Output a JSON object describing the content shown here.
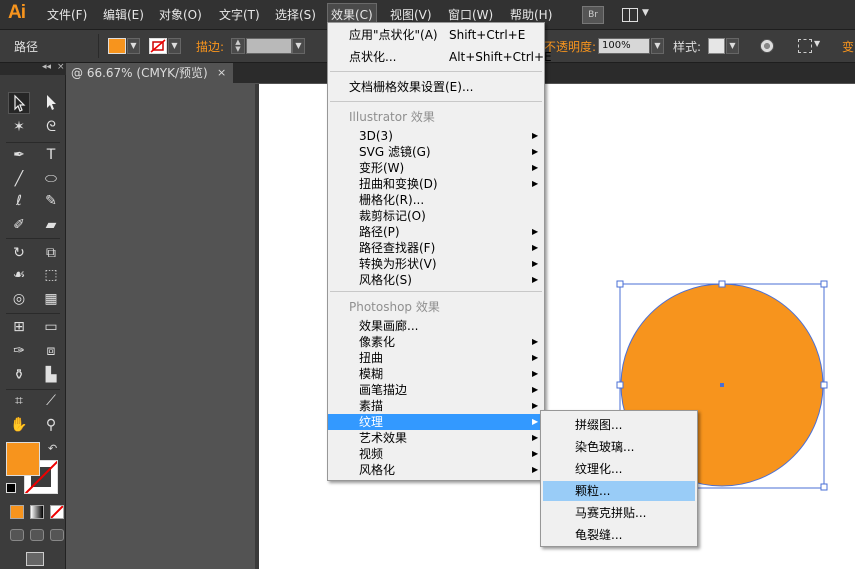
{
  "app": {
    "logo": "Ai"
  },
  "menubar": {
    "items": [
      {
        "label": "文件(F)"
      },
      {
        "label": "编辑(E)"
      },
      {
        "label": "对象(O)"
      },
      {
        "label": "文字(T)"
      },
      {
        "label": "选择(S)"
      },
      {
        "label": "效果(C)"
      },
      {
        "label": "视图(V)"
      },
      {
        "label": "窗口(W)"
      },
      {
        "label": "帮助(H)"
      }
    ],
    "active": "效果(C)",
    "bridge_label": "Br"
  },
  "controlbar": {
    "selection_label": "路径",
    "stroke_label": "描边:",
    "opacity_label": "不透明度:",
    "opacity_value": "100%",
    "style_label": "样式:",
    "transform_label": "变",
    "fill_color": "#f7941d"
  },
  "document": {
    "tab_title": "@ 66.67% (CMYK/预览)",
    "close": "×"
  },
  "tools": {
    "collapse": "◂◂",
    "close": "×"
  },
  "effect_menu": {
    "top_items": [
      {
        "label": "应用\"点状化\"(A)",
        "shortcut": "Shift+Ctrl+E"
      },
      {
        "label": "点状化...",
        "shortcut": "Alt+Shift+Ctrl+E"
      }
    ],
    "raster_settings": "文档栅格效果设置(E)...",
    "illustrator_header": "Illustrator 效果",
    "illustrator_items": [
      {
        "label": "3D(3)",
        "submenu": true
      },
      {
        "label": "SVG 滤镜(G)",
        "submenu": true
      },
      {
        "label": "变形(W)",
        "submenu": true
      },
      {
        "label": "扭曲和变换(D)",
        "submenu": true
      },
      {
        "label": "栅格化(R)...",
        "submenu": false
      },
      {
        "label": "裁剪标记(O)",
        "submenu": false
      },
      {
        "label": "路径(P)",
        "submenu": true
      },
      {
        "label": "路径查找器(F)",
        "submenu": true
      },
      {
        "label": "转换为形状(V)",
        "submenu": true
      },
      {
        "label": "风格化(S)",
        "submenu": true
      }
    ],
    "photoshop_header": "Photoshop 效果",
    "photoshop_items": [
      {
        "label": "效果画廊...",
        "submenu": false
      },
      {
        "label": "像素化",
        "submenu": true
      },
      {
        "label": "扭曲",
        "submenu": true
      },
      {
        "label": "模糊",
        "submenu": true
      },
      {
        "label": "画笔描边",
        "submenu": true
      },
      {
        "label": "素描",
        "submenu": true
      },
      {
        "label": "纹理",
        "submenu": true,
        "highlighted": true
      },
      {
        "label": "艺术效果",
        "submenu": true
      },
      {
        "label": "视频",
        "submenu": true
      },
      {
        "label": "风格化",
        "submenu": true
      }
    ]
  },
  "texture_submenu": {
    "items": [
      {
        "label": "拼缀图..."
      },
      {
        "label": "染色玻璃..."
      },
      {
        "label": "纹理化..."
      },
      {
        "label": "颗粒...",
        "hovered": true
      },
      {
        "label": "马赛克拼贴..."
      },
      {
        "label": "龟裂缝..."
      }
    ]
  },
  "colors": {
    "accent": "#f7941d",
    "menu_highlight": "#3399ff",
    "submenu_hover": "#99ccf7",
    "selection_blue": "#4a6fd6"
  }
}
